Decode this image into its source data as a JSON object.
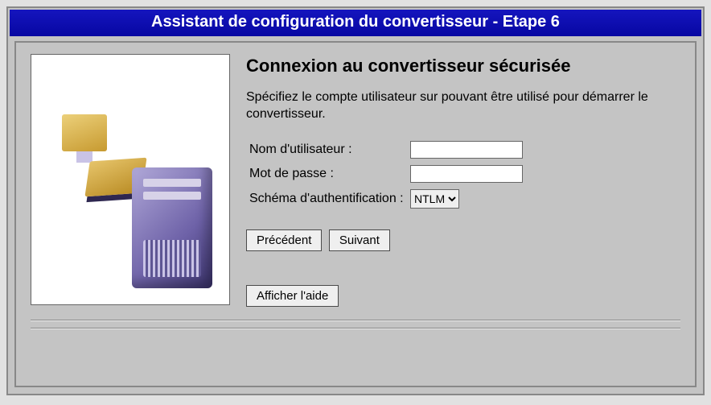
{
  "title": "Assistant de configuration du convertisseur - Etape 6",
  "heading": "Connexion au convertisseur sécurisée",
  "description": "Spécifiez le compte utilisateur sur pouvant être utilisé pour démarrer le convertisseur.",
  "form": {
    "username_label": "Nom d'utilisateur :",
    "username_value": "",
    "password_label": "Mot de passe :",
    "password_value": "",
    "authscheme_label": "Schéma d'authentification :",
    "authscheme_selected": "NTLM"
  },
  "buttons": {
    "previous": "Précédent",
    "next": "Suivant",
    "help": "Afficher l'aide"
  }
}
